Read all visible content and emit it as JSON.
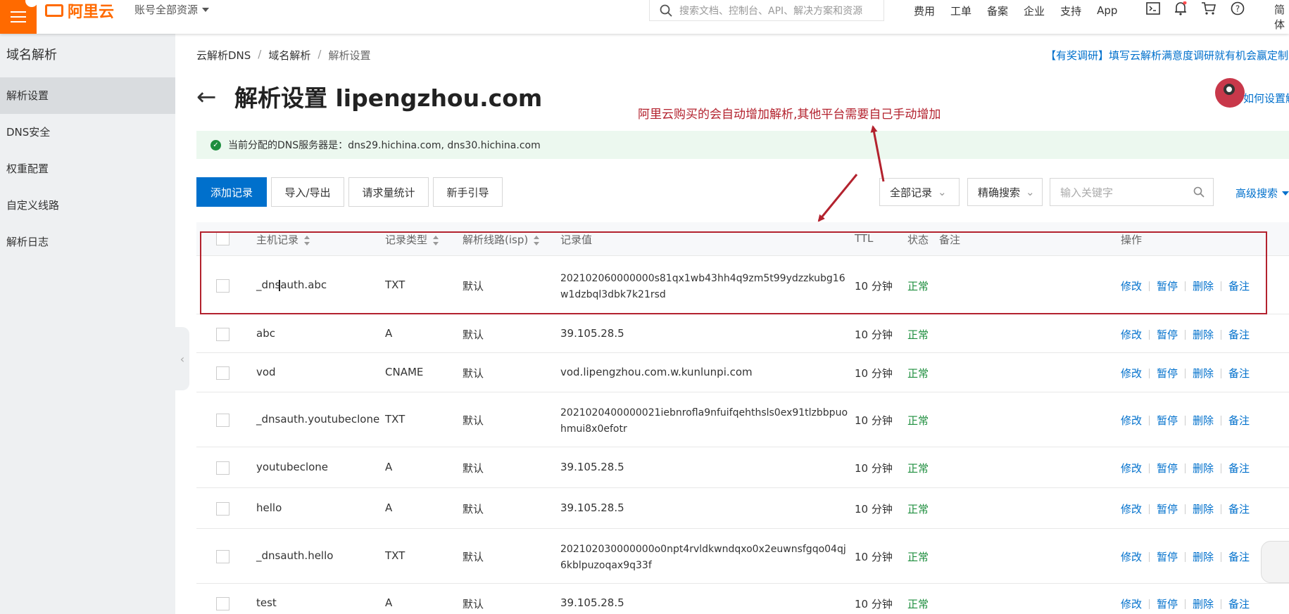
{
  "topbar": {
    "logo_text": "阿里云",
    "account": "账号全部资源",
    "search_placeholder": "搜索文档、控制台、API、解决方案和资源",
    "nav": [
      "费用",
      "工单",
      "备案",
      "企业",
      "支持",
      "App"
    ],
    "right_text": "简体"
  },
  "sidebar": {
    "title": "域名解析",
    "items": [
      {
        "label": "解析设置",
        "active": true
      },
      {
        "label": "DNS安全",
        "active": false
      },
      {
        "label": "权重配置",
        "active": false
      },
      {
        "label": "自定义线路",
        "active": false
      },
      {
        "label": "解析日志",
        "active": false
      }
    ]
  },
  "breadcrumb": [
    "云解析DNS",
    "域名解析",
    "解析设置"
  ],
  "survey_link": "【有奖调研】填写云解析满意度调研就有机会赢定制",
  "page": {
    "title": "解析设置 lipengzhou.com",
    "help_link": "如何设置解析",
    "annotation": "阿里云购买的会自动增加解析,其他平台需要自己手动增加",
    "dns_info": "当前分配的DNS服务器是：dns29.hichina.com, dns30.hichina.com"
  },
  "toolbar": {
    "add": "添加记录",
    "import_export": "导入/导出",
    "stats": "请求量统计",
    "guide": "新手引导",
    "filter_all": "全部记录",
    "filter_exact": "精确搜索",
    "keyword_placeholder": "输入关键字",
    "advanced": "高级搜索"
  },
  "table": {
    "headers": {
      "host": "主机记录",
      "type": "记录类型",
      "line": "解析线路(isp)",
      "value": "记录值",
      "ttl": "TTL",
      "status": "状态",
      "note": "备注",
      "ops": "操作"
    },
    "ops": [
      "修改",
      "暂停",
      "删除",
      "备注"
    ],
    "rows": [
      {
        "host": "_dnsauth.abc",
        "type": "TXT",
        "line": "默认",
        "value": "202102060000000s81qx1wb43hh4q9zm5t99ydzzkubg16w1dzbql3dbk7k21rsd",
        "ttl": "10 分钟",
        "status": "正常"
      },
      {
        "host": "abc",
        "type": "A",
        "line": "默认",
        "value": "39.105.28.5",
        "ttl": "10 分钟",
        "status": "正常"
      },
      {
        "host": "vod",
        "type": "CNAME",
        "line": "默认",
        "value": "vod.lipengzhou.com.w.kunlunpi.com",
        "ttl": "10 分钟",
        "status": "正常"
      },
      {
        "host": "_dnsauth.youtubeclone",
        "type": "TXT",
        "line": "默认",
        "value": "2021020400000021iebnrofla9nfuifqehthsls0ex91tlzbbpuohmui8x0efotr",
        "ttl": "10 分钟",
        "status": "正常"
      },
      {
        "host": "youtubeclone",
        "type": "A",
        "line": "默认",
        "value": "39.105.28.5",
        "ttl": "10 分钟",
        "status": "正常"
      },
      {
        "host": "hello",
        "type": "A",
        "line": "默认",
        "value": "39.105.28.5",
        "ttl": "10 分钟",
        "status": "正常"
      },
      {
        "host": "_dnsauth.hello",
        "type": "TXT",
        "line": "默认",
        "value": "202102030000000o0npt4rvldkwndqxo0x2euwnsfgqo04qj6kblpuzoqax9q33f",
        "ttl": "10 分钟",
        "status": "正常"
      },
      {
        "host": "test",
        "type": "A",
        "line": "默认",
        "value": "39.105.28.5",
        "ttl": "10 分钟",
        "status": "正常"
      }
    ]
  },
  "colors": {
    "brand": "#ff6a00",
    "primary": "#0070cc",
    "ok": "#1e8e3e",
    "annotation": "#b3222e"
  }
}
